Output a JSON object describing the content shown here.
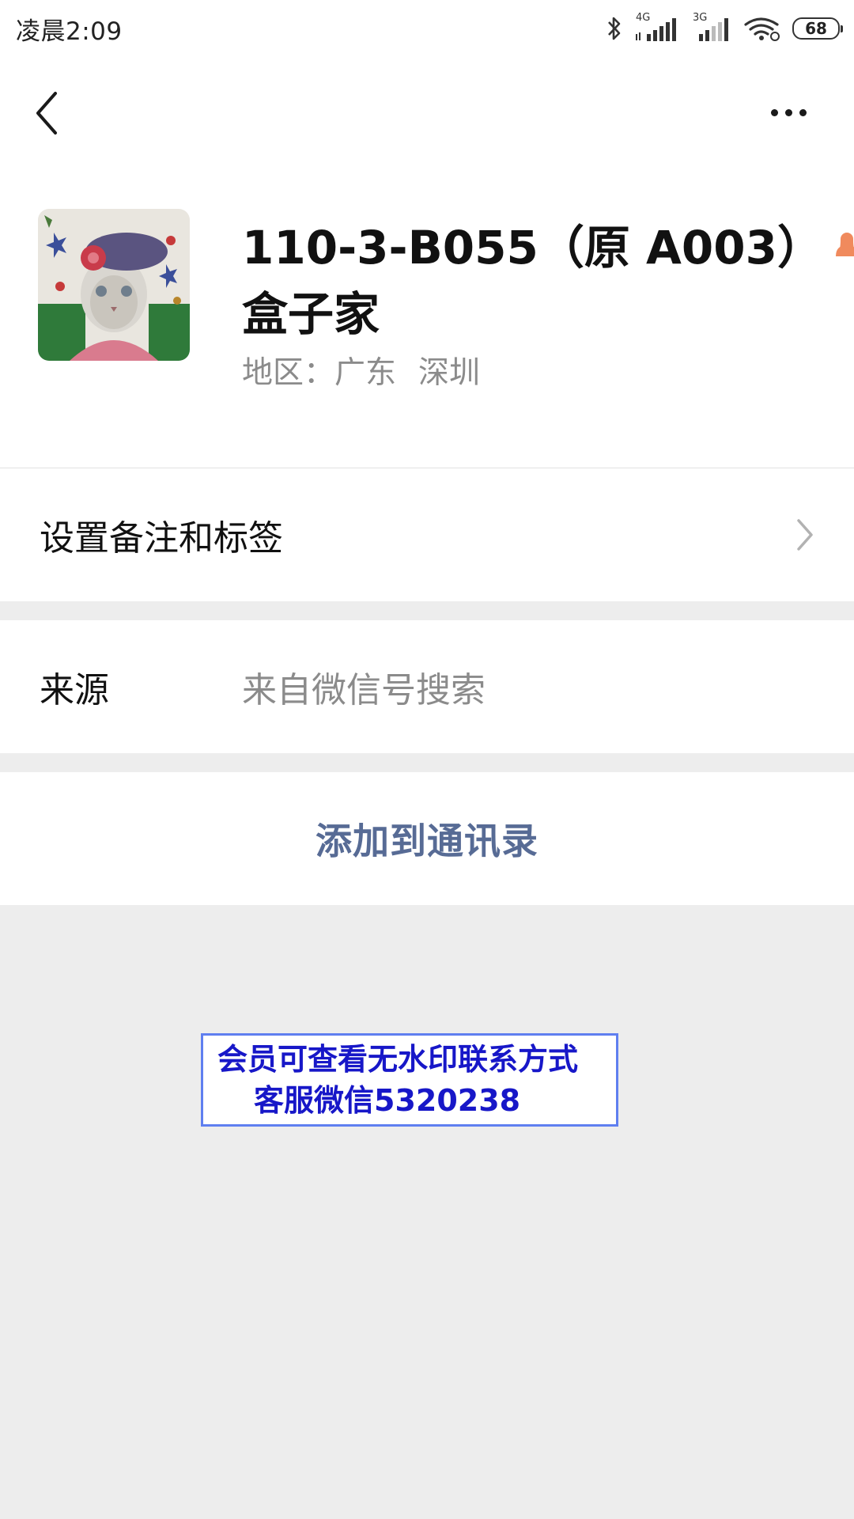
{
  "status_bar": {
    "time": "凌晨2:09",
    "network1": "4G",
    "network2": "3G",
    "battery": "68"
  },
  "nav": {
    "back_icon": "chevron-left-icon",
    "more_icon": "more-dots-icon"
  },
  "profile": {
    "name_line1": "110-3-B055（原 A003）",
    "name_line2": "盒子家",
    "gender_icon": "female-person-icon",
    "gender_color": "#f08a5d",
    "region_label": "地区：",
    "region_province": "广东",
    "region_city": "深圳"
  },
  "remark_row": {
    "label": "设置备注和标签"
  },
  "source_row": {
    "key": "来源",
    "value": "来自微信号搜索"
  },
  "add_button": {
    "label": "添加到通讯录",
    "color": "#576b95"
  },
  "watermark": {
    "line1": "会员可查看无水印联系方式",
    "line2": "客服微信5320238"
  }
}
